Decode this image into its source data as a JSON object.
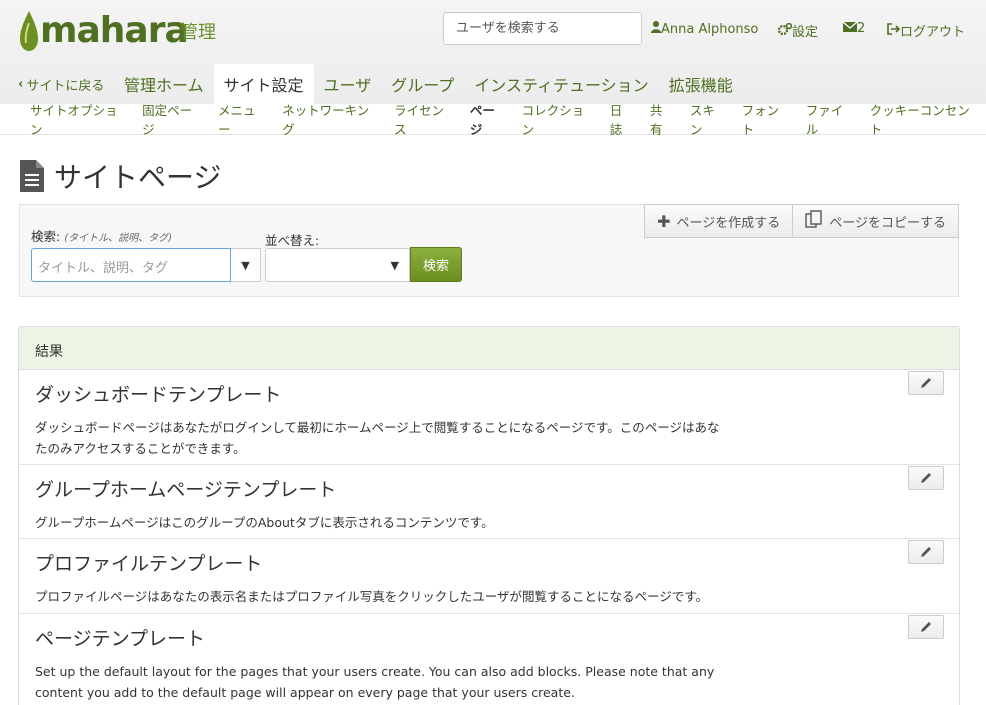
{
  "header": {
    "logo_text": "mahara",
    "admin_label": "管理",
    "search_placeholder": "ユーザを検索する",
    "user_name": "Anna Alphonso",
    "settings_label": "設定",
    "messages_count": "2",
    "logout_label": "ログアウト",
    "brand_color": "#4f6f22"
  },
  "mainnav": {
    "back_label": "サイトに戻る",
    "items": [
      {
        "label": "管理ホーム",
        "active": false
      },
      {
        "label": "サイト設定",
        "active": true
      },
      {
        "label": "ユーザ",
        "active": false
      },
      {
        "label": "グループ",
        "active": false
      },
      {
        "label": "インスティテューション",
        "active": false
      },
      {
        "label": "拡張機能",
        "active": false
      }
    ]
  },
  "subnav": {
    "items": [
      {
        "label": "サイトオプション",
        "active": false
      },
      {
        "label": "固定ページ",
        "active": false
      },
      {
        "label": "メニュー",
        "active": false
      },
      {
        "label": "ネットワーキング",
        "active": false
      },
      {
        "label": "ライセンス",
        "active": false
      },
      {
        "label": "ページ",
        "active": true
      },
      {
        "label": "コレクション",
        "active": false
      },
      {
        "label": "日誌",
        "active": false
      },
      {
        "label": "共有",
        "active": false
      },
      {
        "label": "スキン",
        "active": false
      },
      {
        "label": "フォント",
        "active": false
      },
      {
        "label": "ファイル",
        "active": false
      },
      {
        "label": "クッキーコンセント",
        "active": false
      }
    ]
  },
  "page": {
    "title": "サイトページ"
  },
  "search": {
    "label": "検索:",
    "hint": "(タイトル、説明、タグ)",
    "placeholder": "タイトル、説明、タグ",
    "sort_label": "並べ替え:",
    "sort_value": "",
    "button_label": "検索",
    "create_page_label": "ページを作成する",
    "copy_page_label": "ページをコピーする"
  },
  "results": {
    "heading": "結果",
    "items": [
      {
        "title": "ダッシュボードテンプレート",
        "description": "ダッシュボードページはあなたがログインして最初にホームページ上で閲覧することになるページです。このページはあなたのみアクセスすることができます。"
      },
      {
        "title": "グループホームページテンプレート",
        "description": "グループホームページはこのグループのAboutタブに表示されるコンテンツです。"
      },
      {
        "title": "プロファイルテンプレート",
        "description": "プロファイルページはあなたの表示名またはプロファイル写真をクリックしたユーザが閲覧することになるページです。"
      },
      {
        "title": "ページテンプレート",
        "description": "Set up the default layout for the pages that your users create. You can also add blocks. Please note that any content you add to the default page will appear on every page that your users create."
      }
    ]
  }
}
